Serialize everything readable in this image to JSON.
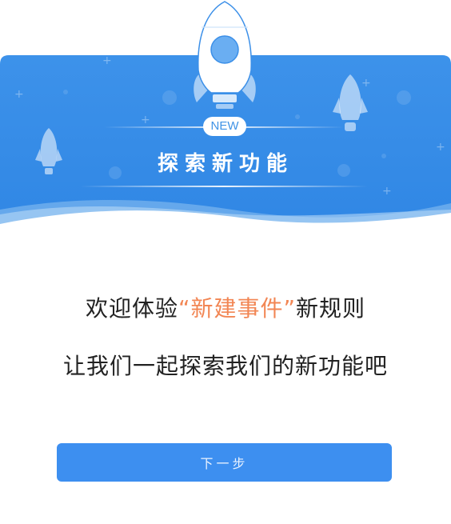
{
  "banner": {
    "badge": "NEW",
    "title": "探索新功能",
    "background_color": "#3b8fe8"
  },
  "content": {
    "welcome_prefix": "欢迎体验",
    "welcome_highlight": "“新建事件”",
    "welcome_suffix": "新规则",
    "explore_line": "让我们一起探索我们的新功能吧",
    "highlight_color": "#f28654"
  },
  "actions": {
    "next_label": "下一步",
    "button_color": "#3d8ff0"
  }
}
